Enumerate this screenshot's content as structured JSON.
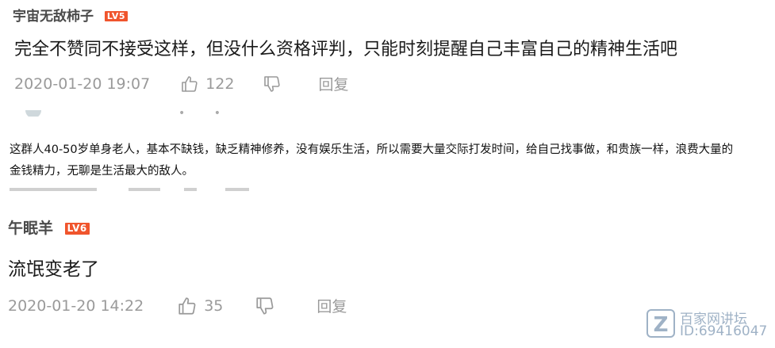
{
  "comments": [
    {
      "username": "宇宙无敌柿子",
      "level": "LV5",
      "text": "完全不赞同不接受这样，但没什么资格评判，只能时刻提醒自己丰富自己的精神生活吧",
      "date": "2020-01-20 19:07",
      "likes": "122",
      "reply_label": "回复"
    },
    {
      "username": "午眠羊",
      "level": "LV6",
      "text": "流氓变老了",
      "date": "2020-01-20 14:22",
      "likes": "35",
      "reply_label": "回复"
    }
  ],
  "quote": {
    "text": "这群人40-50岁单身老人，基本不缺钱，缺乏精神修养，没有娱乐生活，所以需要大量交际打发时间，给自己找事做，和贵族一样，浪费大量的金钱精力，无聊是生活最大的敌人。"
  },
  "watermark": {
    "line1": "百家网讲坛",
    "line2": "ID:69416047"
  },
  "colors": {
    "level_badge": "#f0552d",
    "meta_text": "#9a9a9a",
    "watermark": "#9fb2c6"
  },
  "icons": [
    "thumbs-up-icon",
    "thumbs-down-icon"
  ]
}
